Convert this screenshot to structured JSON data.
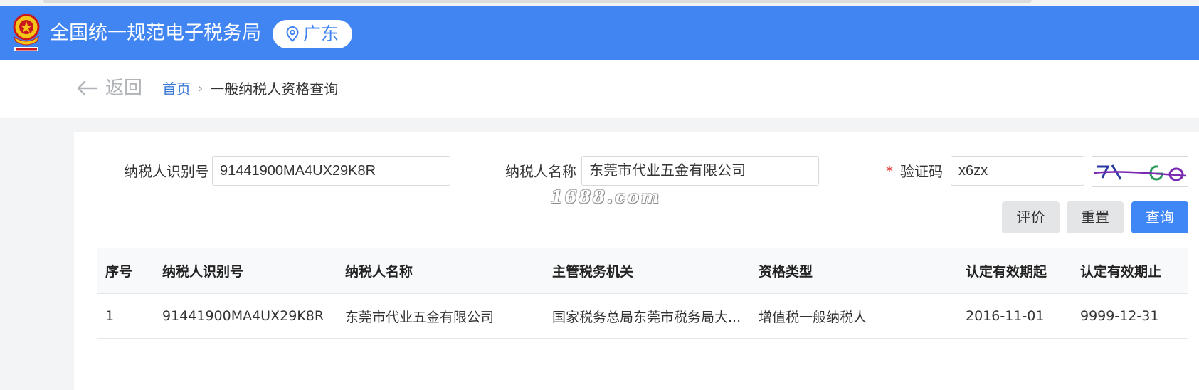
{
  "header": {
    "title": "全国统一规范电子税务局",
    "region": "广东",
    "emblem_icon": "tax-emblem-icon",
    "location_icon": "map-pin-icon",
    "color": "#4185f2"
  },
  "nav": {
    "back_label": "返回",
    "breadcrumb_home": "首页",
    "breadcrumb_separator": "›",
    "breadcrumb_current": "一般纳税人资格查询"
  },
  "form": {
    "taxpayer_id_label": "纳税人识别号",
    "taxpayer_id_value": "91441900MA4UX29K8R",
    "taxpayer_name_label": "纳税人名称",
    "taxpayer_name_value": "东莞市代业五金有限公司",
    "captcha_required_mark": "*",
    "captcha_label": "验证码",
    "captcha_value": "x6zx",
    "captcha_image_text": "7\\Go"
  },
  "watermark": "1688.com",
  "buttons": {
    "evaluate": "评价",
    "reset": "重置",
    "query": "查询",
    "primary_color": "#3f86f7"
  },
  "table": {
    "headers": [
      "序号",
      "纳税人识别号",
      "纳税人名称",
      "主管税务机关",
      "资格类型",
      "认定有效期起",
      "认定有效期止"
    ],
    "rows": [
      [
        "1",
        "91441900MA4UX29K8R",
        "东莞市代业五金有限公司",
        "国家税务总局东莞市税务局大...",
        "增值税一般纳税人",
        "2016-11-01",
        "9999-12-31"
      ]
    ]
  }
}
